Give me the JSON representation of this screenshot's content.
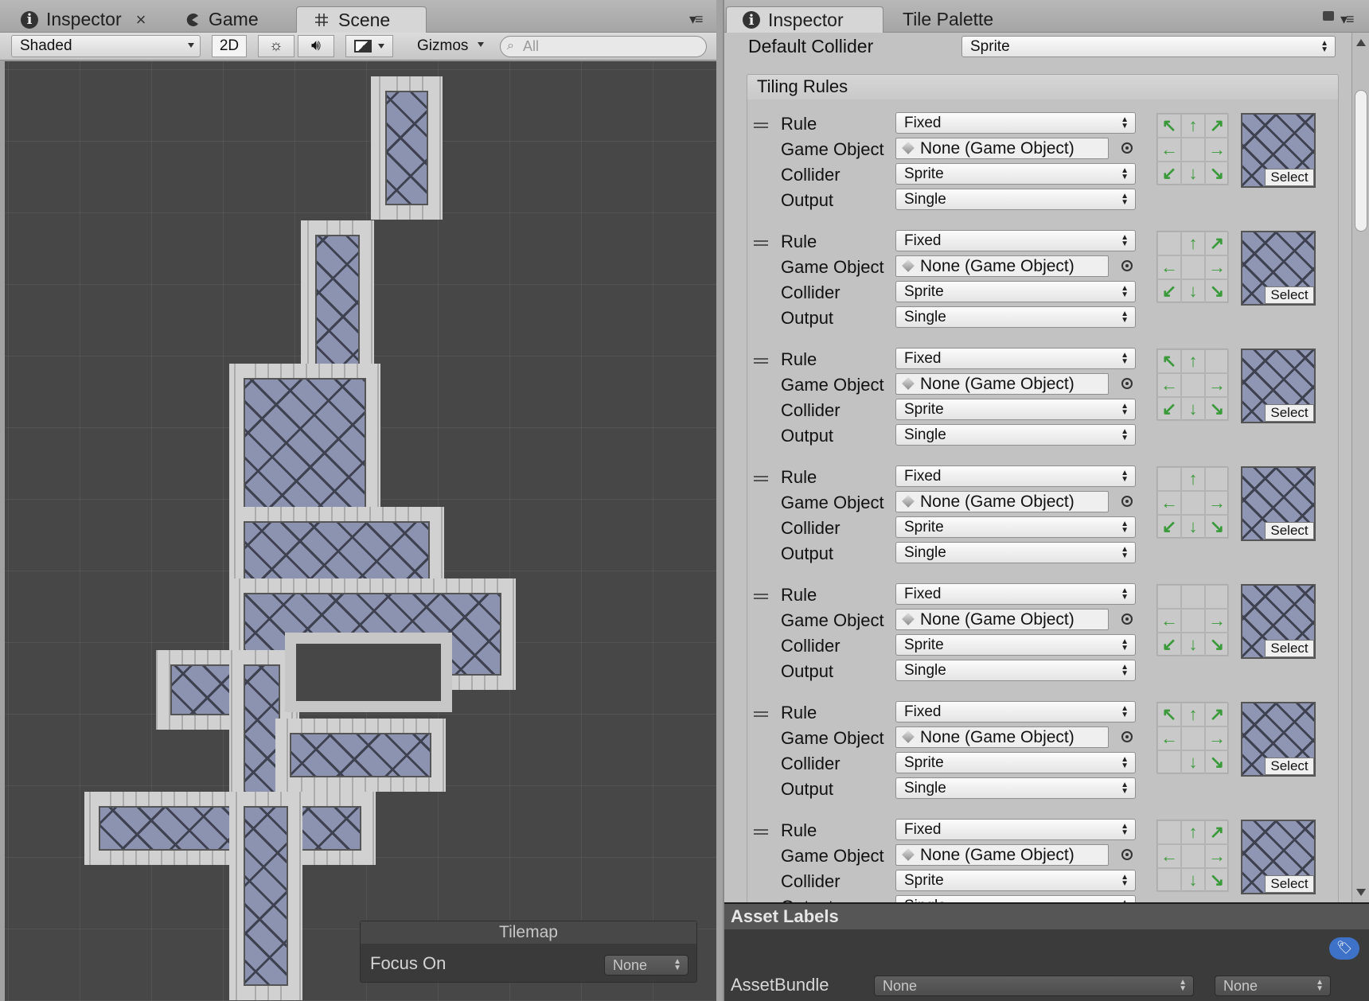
{
  "left_panel": {
    "tabs": [
      {
        "label": "Inspector",
        "icon": "info-icon"
      },
      {
        "label": "Game",
        "icon": "pacman-icon"
      },
      {
        "label": "Scene",
        "icon": "grid-icon",
        "active": true
      }
    ],
    "close_glyph": "×",
    "toolbar": {
      "shading_mode": "Shaded",
      "mode_2d": "2D",
      "gizmos": "Gizmos",
      "search_placeholder": "All"
    },
    "tilemap_overlay": {
      "title": "Tilemap",
      "focus_label": "Focus On",
      "focus_value": "None"
    }
  },
  "right_panel": {
    "tabs": [
      {
        "label": "Inspector",
        "icon": "info-icon",
        "active": true
      },
      {
        "label": "Tile Palette"
      }
    ],
    "default_collider": {
      "label": "Default Collider",
      "value": "Sprite"
    },
    "tiling_rules_title": "Tiling Rules",
    "field_labels": {
      "rule": "Rule",
      "game_object": "Game Object",
      "collider": "Collider",
      "output": "Output"
    },
    "select_label": "Select",
    "rules": [
      {
        "rule": "Fixed",
        "game_object": "None (Game Object)",
        "collider": "Sprite",
        "output": "Single",
        "neighbors": [
          "↖",
          "↑",
          "↗",
          "←",
          "",
          "→",
          "↙",
          "↓",
          "↘"
        ]
      },
      {
        "rule": "Fixed",
        "game_object": "None (Game Object)",
        "collider": "Sprite",
        "output": "Single",
        "neighbors": [
          "",
          "↑",
          "↗",
          "←",
          "",
          "→",
          "↙",
          "↓",
          "↘"
        ]
      },
      {
        "rule": "Fixed",
        "game_object": "None (Game Object)",
        "collider": "Sprite",
        "output": "Single",
        "neighbors": [
          "↖",
          "↑",
          "",
          "←",
          "",
          "→",
          "↙",
          "↓",
          "↘"
        ]
      },
      {
        "rule": "Fixed",
        "game_object": "None (Game Object)",
        "collider": "Sprite",
        "output": "Single",
        "neighbors": [
          "",
          "↑",
          "",
          "←",
          "",
          "→",
          "↙",
          "↓",
          "↘"
        ]
      },
      {
        "rule": "Fixed",
        "game_object": "None (Game Object)",
        "collider": "Sprite",
        "output": "Single",
        "neighbors": [
          "",
          "",
          "",
          "←",
          "",
          "→",
          "↙",
          "↓",
          "↘"
        ]
      },
      {
        "rule": "Fixed",
        "game_object": "None (Game Object)",
        "collider": "Sprite",
        "output": "Single",
        "neighbors": [
          "↖",
          "↑",
          "↗",
          "←",
          "",
          "→",
          "",
          "↓",
          "↘"
        ]
      },
      {
        "rule": "Fixed",
        "game_object": "None (Game Object)",
        "collider": "Sprite",
        "output": "Single",
        "neighbors": [
          "",
          "↑",
          "↗",
          "←",
          "",
          "→",
          "",
          "↓",
          "↘"
        ]
      }
    ],
    "asset_labels": {
      "title": "Asset Labels",
      "assetbundle_label": "AssetBundle",
      "bundle_name": "None",
      "bundle_variant": "None"
    }
  }
}
